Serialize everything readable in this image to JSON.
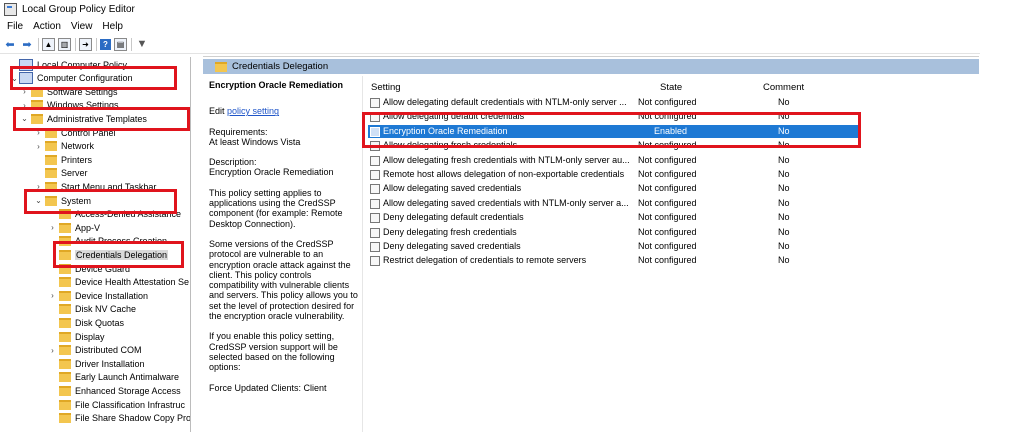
{
  "window": {
    "title": "Local Group Policy Editor"
  },
  "menu": [
    "File",
    "Action",
    "View",
    "Help"
  ],
  "tree": {
    "rows": [
      {
        "label": "Local Computer Policy",
        "arrow": "",
        "icon": "policy"
      },
      {
        "label": "Computer Configuration",
        "arrow": "⌄",
        "icon": "computer"
      },
      {
        "label": "Software Settings",
        "arrow": "›",
        "icon": "folder"
      },
      {
        "label": "Windows Settings",
        "arrow": "›",
        "icon": "folder"
      },
      {
        "label": "Administrative Templates",
        "arrow": "⌄",
        "icon": "folder"
      },
      {
        "label": "Control Panel",
        "arrow": "›",
        "icon": "folder"
      },
      {
        "label": "Network",
        "arrow": "›",
        "icon": "folder"
      },
      {
        "label": "Printers",
        "arrow": "",
        "icon": "folder"
      },
      {
        "label": "Server",
        "arrow": "",
        "icon": "folder"
      },
      {
        "label": "Start Menu and Taskbar",
        "arrow": "›",
        "icon": "folder"
      },
      {
        "label": "System",
        "arrow": "⌄",
        "icon": "folder"
      },
      {
        "label": "Access-Denied Assistance",
        "arrow": "",
        "icon": "folder"
      },
      {
        "label": "App-V",
        "arrow": "›",
        "icon": "folder"
      },
      {
        "label": "Audit Process Creation",
        "arrow": "",
        "icon": "folder"
      },
      {
        "label": "Credentials Delegation",
        "arrow": "",
        "icon": "folder",
        "selected": true
      },
      {
        "label": "Device Guard",
        "arrow": "",
        "icon": "folder"
      },
      {
        "label": "Device Health Attestation Se",
        "arrow": "",
        "icon": "folder"
      },
      {
        "label": "Device Installation",
        "arrow": "›",
        "icon": "folder"
      },
      {
        "label": "Disk NV Cache",
        "arrow": "",
        "icon": "folder"
      },
      {
        "label": "Disk Quotas",
        "arrow": "",
        "icon": "folder"
      },
      {
        "label": "Display",
        "arrow": "",
        "icon": "folder"
      },
      {
        "label": "Distributed COM",
        "arrow": "›",
        "icon": "folder"
      },
      {
        "label": "Driver Installation",
        "arrow": "",
        "icon": "folder"
      },
      {
        "label": "Early Launch Antimalware",
        "arrow": "",
        "icon": "folder"
      },
      {
        "label": "Enhanced Storage Access",
        "arrow": "",
        "icon": "folder"
      },
      {
        "label": "File Classification Infrastruc",
        "arrow": "",
        "icon": "folder"
      },
      {
        "label": "File Share Shadow Copy Pro",
        "arrow": "",
        "icon": "folder"
      }
    ]
  },
  "panel": {
    "header": "Credentials Delegation",
    "policy_title": "Encryption Oracle Remediation",
    "edit_prefix": "Edit ",
    "edit_link": "policy setting",
    "requirements_label": "Requirements:",
    "requirements_value": "At least Windows Vista",
    "description_label": "Description:",
    "description_value": "Encryption Oracle Remediation",
    "para1": "This policy setting applies to applications using the CredSSP component (for example: Remote Desktop Connection).",
    "para2": "Some versions of the CredSSP protocol are vulnerable to an encryption oracle attack against the client.  This policy controls compatibility with vulnerable clients and servers.  This policy allows you to set the level of protection desired for the encryption oracle vulnerability.",
    "para3": "If you enable this policy setting, CredSSP version support will be selected based on the following options:",
    "para4": "Force Updated Clients: Client"
  },
  "table": {
    "columns": {
      "setting": "Setting",
      "state": "State",
      "comment": "Comment"
    },
    "rows": [
      {
        "setting": "Allow delegating default credentials with NTLM-only server ...",
        "state": "Not configured",
        "comment": "No"
      },
      {
        "setting": "Allow delegating default credentials",
        "state": "Not configured",
        "comment": "No"
      },
      {
        "setting": "Encryption Oracle Remediation",
        "state": "Enabled",
        "comment": "No",
        "selected": true
      },
      {
        "setting": "Allow delegating fresh credentials",
        "state": "Not configured",
        "comment": "No"
      },
      {
        "setting": "Allow delegating fresh credentials with NTLM-only server au...",
        "state": "Not configured",
        "comment": "No"
      },
      {
        "setting": "Remote host allows delegation of non-exportable credentials",
        "state": "Not configured",
        "comment": "No"
      },
      {
        "setting": "Allow delegating saved credentials",
        "state": "Not configured",
        "comment": "No"
      },
      {
        "setting": "Allow delegating saved credentials with NTLM-only server a...",
        "state": "Not configured",
        "comment": "No"
      },
      {
        "setting": "Deny delegating default credentials",
        "state": "Not configured",
        "comment": "No"
      },
      {
        "setting": "Deny delegating fresh credentials",
        "state": "Not configured",
        "comment": "No"
      },
      {
        "setting": "Deny delegating saved credentials",
        "state": "Not configured",
        "comment": "No"
      },
      {
        "setting": "Restrict delegation of credentials to remote servers",
        "state": "Not configured",
        "comment": "No"
      }
    ]
  },
  "colors": {
    "selection": "#1e79d4",
    "highlight_box": "#e0141d",
    "header_bar": "#a8c0dc"
  }
}
